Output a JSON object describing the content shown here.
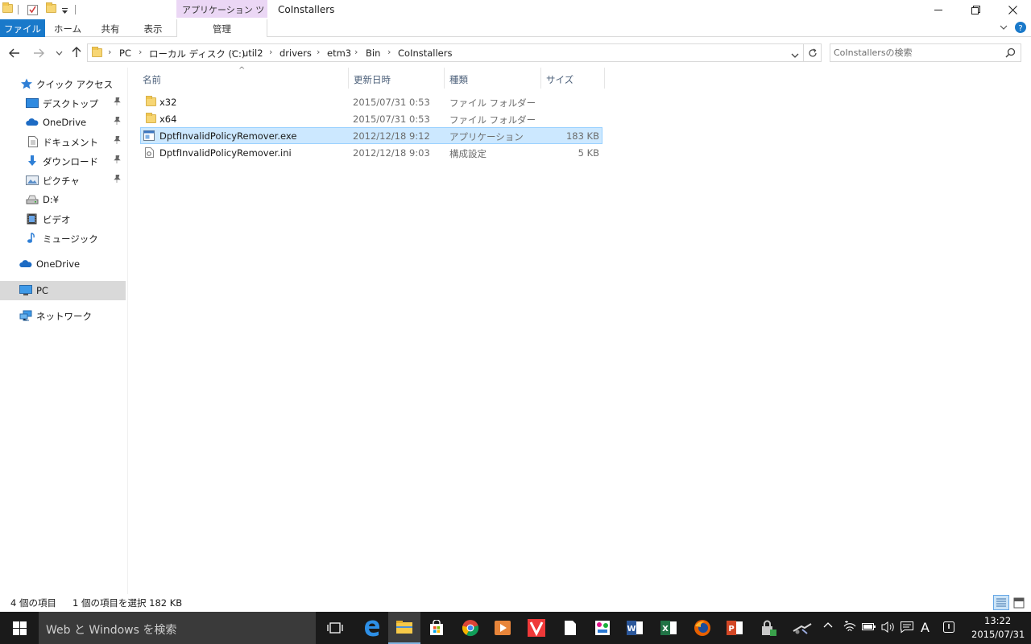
{
  "window": {
    "title": "CoInstallers",
    "context_tab_header": "アプリケーション ツール",
    "minimize": "—",
    "restore": "❐",
    "close": "✕"
  },
  "ribbon": {
    "tabs": [
      "ファイル",
      "ホーム",
      "共有",
      "表示",
      "管理"
    ],
    "expand_icon": "chevron-down-icon",
    "help_icon": "help-icon"
  },
  "navigation": {
    "back": "←",
    "forward": "→",
    "recent": "⌄",
    "up": "↑"
  },
  "address": {
    "crumbs": [
      "PC",
      "ローカル ディスク (C:)",
      "util2",
      "drivers",
      "etm3",
      "Bin",
      "CoInstallers"
    ],
    "separator": "›",
    "refresh": "↻"
  },
  "search": {
    "placeholder": "CoInstallersの検索"
  },
  "sidebar": {
    "items": [
      {
        "label": "クイック アクセス",
        "icon": "star-icon"
      },
      {
        "label": "デスクトップ",
        "icon": "desktop-icon",
        "pinned": true
      },
      {
        "label": "OneDrive",
        "icon": "cloud-icon",
        "pinned": true
      },
      {
        "label": "ドキュメント",
        "icon": "document-icon",
        "pinned": true
      },
      {
        "label": "ダウンロード",
        "icon": "download-icon",
        "pinned": true
      },
      {
        "label": "ピクチャ",
        "icon": "picture-icon",
        "pinned": true
      },
      {
        "label": "D:¥",
        "icon": "drive-icon"
      },
      {
        "label": "ビデオ",
        "icon": "video-icon"
      },
      {
        "label": "ミュージック",
        "icon": "music-icon"
      },
      {
        "label": "OneDrive",
        "icon": "cloud-icon"
      },
      {
        "label": "PC",
        "icon": "computer-icon",
        "selected": true
      },
      {
        "label": "ネットワーク",
        "icon": "network-icon"
      }
    ],
    "pin_glyph": "📌"
  },
  "filelist": {
    "columns": [
      "名前",
      "更新日時",
      "種類",
      "サイズ"
    ],
    "sort_indicator": "^",
    "rows": [
      {
        "name": "x32",
        "date": "2015/07/31 0:53",
        "type": "ファイル フォルダー",
        "size": "",
        "icon": "folder-icon"
      },
      {
        "name": "x64",
        "date": "2015/07/31 0:53",
        "type": "ファイル フォルダー",
        "size": "",
        "icon": "folder-icon"
      },
      {
        "name": "DptfInvalidPolicyRemover.exe",
        "date": "2012/12/18 9:12",
        "type": "アプリケーション",
        "size": "183 KB",
        "icon": "exe-icon",
        "selected": true
      },
      {
        "name": "DptfInvalidPolicyRemover.ini",
        "date": "2012/12/18 9:03",
        "type": "構成設定",
        "size": "5 KB",
        "icon": "settings-file-icon"
      }
    ]
  },
  "status": {
    "item_count": "4 個の項目",
    "selection": "1 個の項目を選択  182 KB"
  },
  "taskbar": {
    "search_text": "Web と Windows を検索",
    "time": "13:22",
    "date": "2015/07/31",
    "ime": "A",
    "colors": {
      "bg": "#1a1a1a",
      "accent": "#1979ca",
      "selection": "#cce8ff"
    }
  }
}
